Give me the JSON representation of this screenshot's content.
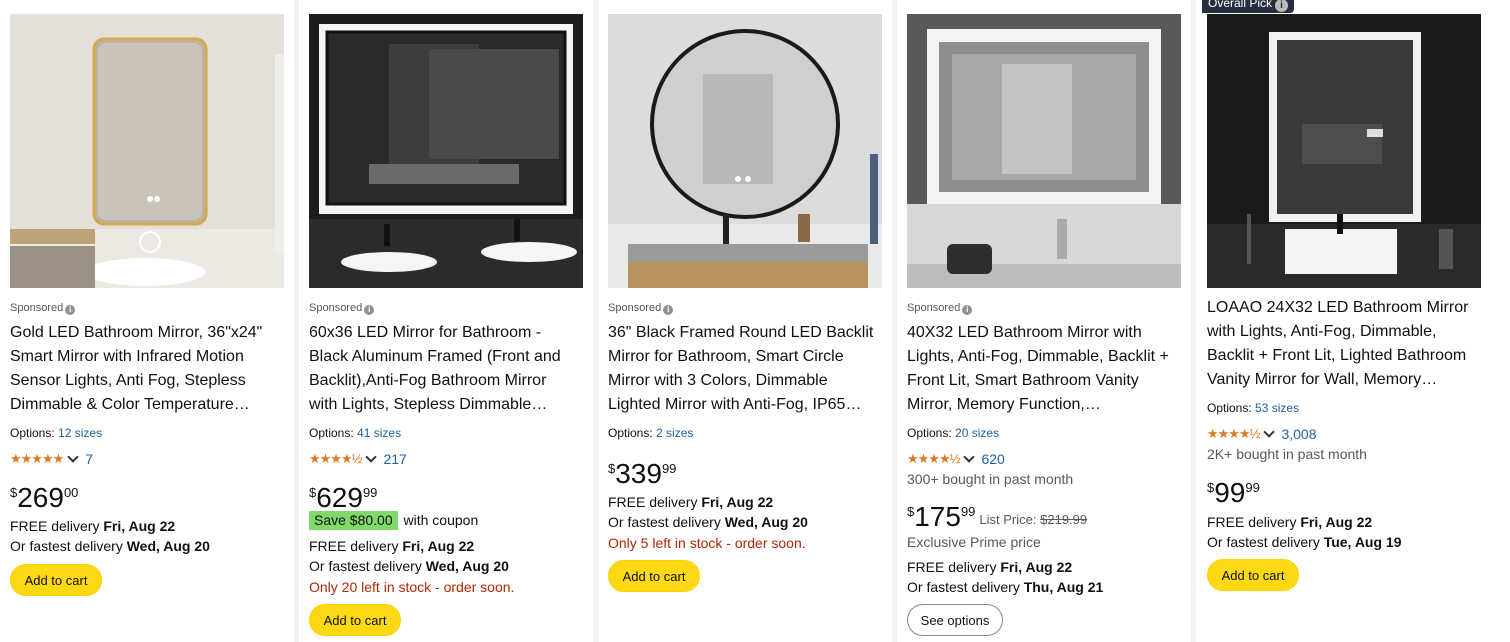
{
  "products": [
    {
      "sponsored": "Sponsored",
      "title": [
        "Gold LED Bathroom Mirror, 36\"x24\"",
        "Smart Mirror with Infrared Motion",
        "Sensor Lights, Anti Fog, Stepless",
        "Dimmable & Color Temperature…"
      ],
      "options_label": "Options:",
      "options_link": "12 sizes",
      "stars": "★★★★★",
      "rating_count": "7",
      "price_sym": "$",
      "price_whole": "269",
      "price_frac": "00",
      "delivery_label": "FREE delivery ",
      "delivery_date": "Fri, Aug 22",
      "fastest_label": "Or fastest delivery ",
      "fastest_date": "Wed, Aug 20",
      "button": "Add to cart"
    },
    {
      "sponsored": "Sponsored",
      "title": [
        "60x36 LED Mirror for Bathroom -",
        "Black Aluminum Framed (Front and",
        "Backlit),Anti-Fog Bathroom Mirror",
        "with Lights, Stepless Dimmable…"
      ],
      "options_label": "Options:",
      "options_link": "41 sizes",
      "stars": "★★★★½",
      "rating_count": "217",
      "price_sym": "$",
      "price_whole": "629",
      "price_frac": "99",
      "coupon_badge": "Save $80.00",
      "coupon_text": "with coupon",
      "delivery_label": "FREE delivery ",
      "delivery_date": "Fri, Aug 22",
      "fastest_label": "Or fastest delivery ",
      "fastest_date": "Wed, Aug 20",
      "stock": "Only 20 left in stock - order soon.",
      "button": "Add to cart"
    },
    {
      "sponsored": "Sponsored",
      "title": [
        "36\" Black Framed Round LED Backlit",
        "Mirror for Bathroom, Smart Circle",
        "Mirror with 3 Colors, Dimmable",
        "Lighted Mirror with Anti-Fog, IP65…"
      ],
      "options_label": "Options:",
      "options_link": "2 sizes",
      "price_sym": "$",
      "price_whole": "339",
      "price_frac": "99",
      "delivery_label": "FREE delivery ",
      "delivery_date": "Fri, Aug 22",
      "fastest_label": "Or fastest delivery ",
      "fastest_date": "Wed, Aug 20",
      "stock": "Only 5 left in stock - order soon.",
      "button": "Add to cart"
    },
    {
      "sponsored": "Sponsored",
      "title": [
        "40X32 LED Bathroom Mirror with",
        "Lights, Anti-Fog, Dimmable, Backlit +",
        "Front Lit, Smart Bathroom Vanity",
        "Mirror, Memory Function,…"
      ],
      "options_label": "Options:",
      "options_link": "20 sizes",
      "stars": "★★★★½",
      "rating_count": "620",
      "bought": "300+ bought in past month",
      "price_sym": "$",
      "price_whole": "175",
      "price_frac": "99",
      "list_price_label": "List Price:",
      "list_price": "$219.99",
      "prime_note": "Exclusive Prime price",
      "delivery_label": "FREE delivery ",
      "delivery_date": "Fri, Aug 22",
      "fastest_label": "Or fastest delivery ",
      "fastest_date": "Thu, Aug 21",
      "button": "See options"
    },
    {
      "badge": "Overall Pick",
      "title": [
        "LOAAO 24X32 LED Bathroom Mirror",
        "with Lights, Anti-Fog, Dimmable,",
        "Backlit + Front Lit, Lighted Bathroom",
        "Vanity Mirror for Wall, Memory…"
      ],
      "options_label": "Options:",
      "options_link": "53 sizes",
      "stars": "★★★★½",
      "rating_count": "3,008",
      "bought": "2K+ bought in past month",
      "price_sym": "$",
      "price_whole": "99",
      "price_frac": "99",
      "delivery_label": "FREE delivery ",
      "delivery_date": "Fri, Aug 22",
      "fastest_label": "Or fastest delivery ",
      "fastest_date": "Tue, Aug 19",
      "button": "Add to cart"
    }
  ],
  "colors": {
    "link": "#2162a1",
    "star": "#de7921",
    "button": "#ffd814",
    "stock": "#b12704",
    "coupon": "#7fda69"
  }
}
